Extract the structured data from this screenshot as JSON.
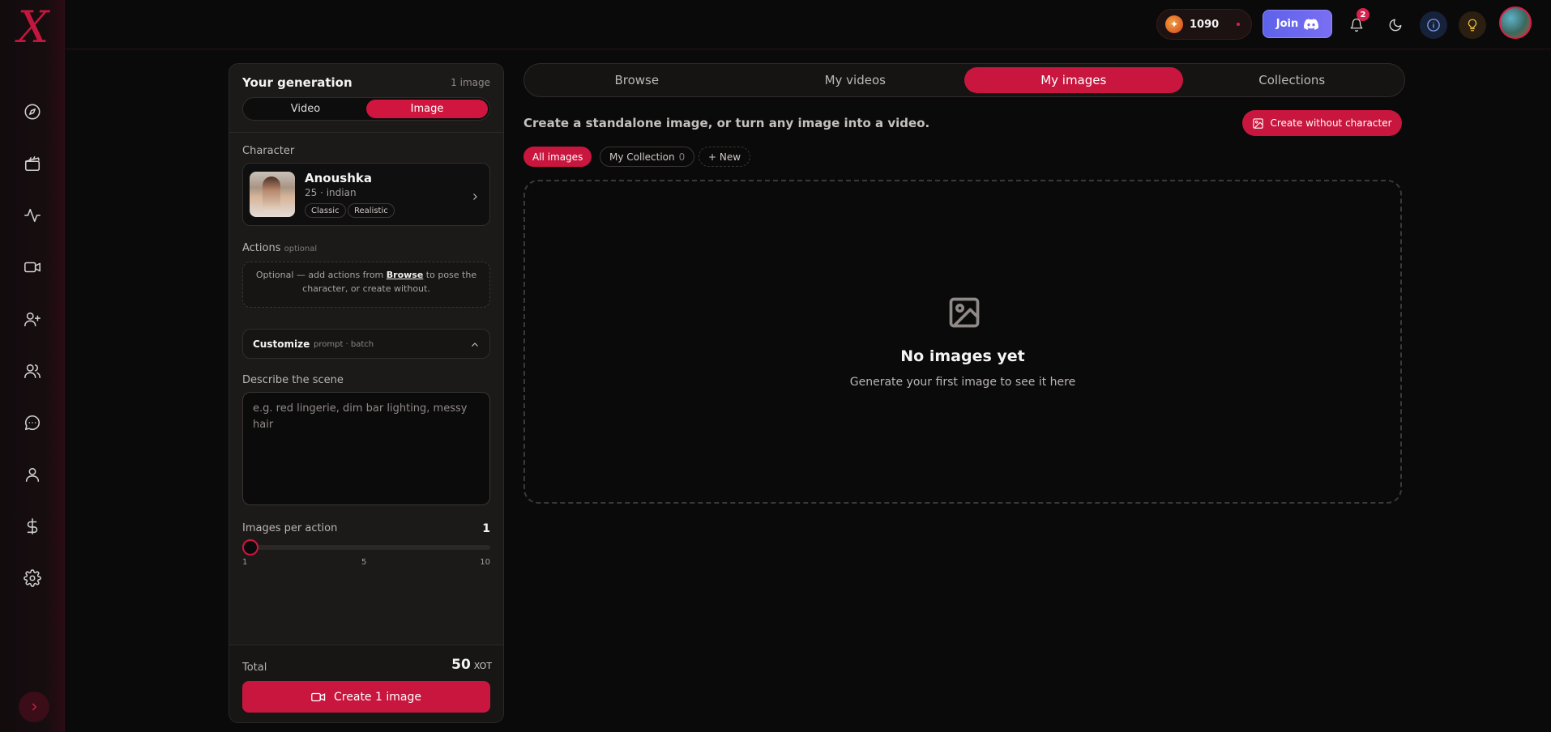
{
  "brand": {
    "logo_text": "X"
  },
  "sidebar": {
    "icons": [
      "compass-icon",
      "clapperboard-icon",
      "activity-icon",
      "video-icon",
      "user-plus-icon",
      "users-icon",
      "chat-icon",
      "user-icon",
      "dollar-icon",
      "settings-icon"
    ],
    "expand_icon": "chevron-right-icon"
  },
  "topbar": {
    "credits": "1090",
    "join_label": "Join",
    "notification_count": "2"
  },
  "generation": {
    "title": "Your generation",
    "count": "1 image",
    "mode_tabs": [
      "Video",
      "Image"
    ],
    "selected_mode": "Image",
    "character_label": "Character",
    "character": {
      "name": "Anoushka",
      "meta": "25 · indian",
      "tags": [
        "Classic",
        "Realistic"
      ]
    },
    "actions_label": "Actions",
    "actions_optional": "optional",
    "actions_hint_before": "Optional — add actions from ",
    "actions_hint_link": "Browse",
    "actions_hint_after": " to pose the character, or create without.",
    "customize_label": "Customize",
    "customize_sub": "prompt · batch",
    "scene_label": "Describe the scene",
    "scene_placeholder": "e.g. red lingerie, dim bar lighting, messy hair",
    "scene_value": "",
    "images_per_action_label": "Images per action",
    "images_per_action": "1",
    "slider_ticks": [
      "1",
      "5",
      "10"
    ],
    "slider_value_fraction": 0,
    "total_label": "Total",
    "total_value": "50",
    "total_unit": "XOT",
    "create_label": "Create 1 image"
  },
  "main": {
    "tabs": [
      "Browse",
      "My videos",
      "My images",
      "Collections"
    ],
    "active_tab": "My images",
    "headline": "Create a standalone image, or turn any image into a video.",
    "create_without_label": "Create without character",
    "filters": {
      "all": "All images",
      "collection": "My Collection",
      "collection_count": "0",
      "new": "+ New"
    },
    "empty_title": "No images yet",
    "empty_sub": "Generate your first image to see it here"
  },
  "colors": {
    "accent": "#c8163e",
    "background": "#0b0a0a",
    "discord": "#5d62ea"
  }
}
